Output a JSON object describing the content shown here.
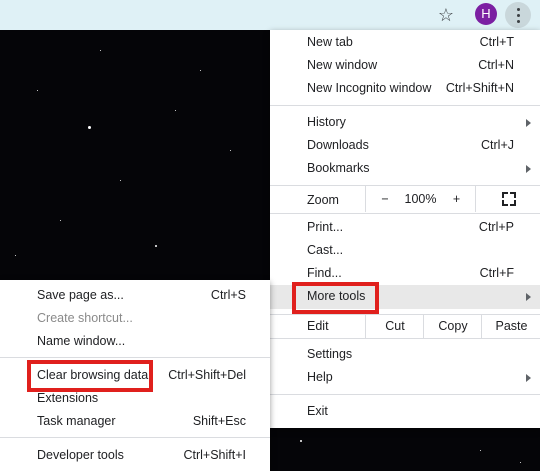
{
  "toolbar": {
    "bookmark_icon": "star-outline-icon",
    "avatar_letter": "H",
    "avatar_color": "#7b1fa2",
    "menu_icon": "three-dots-vertical-icon"
  },
  "menu": {
    "new_tab": {
      "label": "New tab",
      "shortcut": "Ctrl+T"
    },
    "new_window": {
      "label": "New window",
      "shortcut": "Ctrl+N"
    },
    "new_incognito": {
      "label": "New Incognito window",
      "shortcut": "Ctrl+Shift+N"
    },
    "history": {
      "label": "History"
    },
    "downloads": {
      "label": "Downloads",
      "shortcut": "Ctrl+J"
    },
    "bookmarks": {
      "label": "Bookmarks"
    },
    "zoom": {
      "label": "Zoom",
      "minus": "−",
      "value": "100%",
      "plus": "+"
    },
    "print": {
      "label": "Print...",
      "shortcut": "Ctrl+P"
    },
    "cast": {
      "label": "Cast..."
    },
    "find": {
      "label": "Find...",
      "shortcut": "Ctrl+F"
    },
    "more_tools": {
      "label": "More tools"
    },
    "edit": {
      "label": "Edit",
      "cut": "Cut",
      "copy": "Copy",
      "paste": "Paste"
    },
    "settings": {
      "label": "Settings"
    },
    "help": {
      "label": "Help"
    },
    "exit": {
      "label": "Exit"
    }
  },
  "submenu": {
    "save_page": {
      "label": "Save page as...",
      "shortcut": "Ctrl+S"
    },
    "create_shortcut": {
      "label": "Create shortcut..."
    },
    "name_window": {
      "label": "Name window..."
    },
    "clear_browsing": {
      "label": "Clear browsing data.",
      "shortcut": "Ctrl+Shift+Del"
    },
    "extensions": {
      "label": "Extensions"
    },
    "task_manager": {
      "label": "Task manager",
      "shortcut": "Shift+Esc"
    },
    "developer_tools": {
      "label": "Developer tools",
      "shortcut": "Ctrl+Shift+I"
    }
  },
  "highlight_color": "#e0201d"
}
